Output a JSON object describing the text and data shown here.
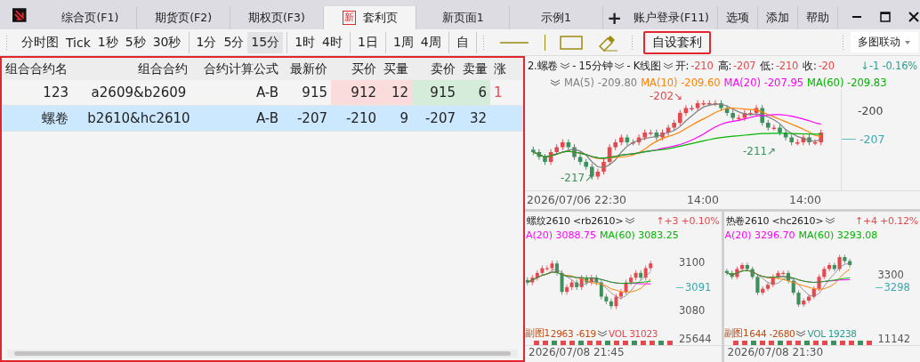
{
  "tabs": [
    {
      "label": "综合页(F1)",
      "selected": false
    },
    {
      "label": "期货页(F2)",
      "selected": false
    },
    {
      "label": "期权页(F3)",
      "selected": false
    },
    {
      "label": "套利页",
      "badge": "新",
      "selected": true
    },
    {
      "label": "新页面1",
      "selected": false
    },
    {
      "label": "示例1",
      "selected": false
    }
  ],
  "add_tab": "+",
  "menu": [
    "账户登录(F11)",
    "选项",
    "添加",
    "帮助"
  ],
  "toolbar": {
    "groups": [
      [
        {
          "label": "分时图",
          "selected": false
        },
        {
          "label": "Tick",
          "selected": false
        },
        {
          "label": "1秒",
          "selected": false
        },
        {
          "label": "5秒",
          "selected": false
        },
        {
          "label": "30秒",
          "selected": false
        }
      ],
      [
        {
          "label": "1分",
          "selected": false
        },
        {
          "label": "5分",
          "selected": false
        },
        {
          "label": "15分",
          "selected": true
        }
      ],
      [
        {
          "label": "1时",
          "selected": false
        },
        {
          "label": "4时",
          "selected": false
        }
      ],
      [
        {
          "label": "1日",
          "selected": false
        }
      ],
      [
        {
          "label": "1周",
          "selected": false
        },
        {
          "label": "4周",
          "selected": false
        }
      ],
      [
        {
          "label": "自",
          "selected": false
        }
      ]
    ],
    "custom_button": "自设套利",
    "linked_charts": "多图联动"
  },
  "table": {
    "columns": [
      {
        "label": "组合合约名",
        "kind": "text"
      },
      {
        "label": "组合合约",
        "kind": "text"
      },
      {
        "label": "合约计算公式",
        "kind": "text"
      },
      {
        "label": "最新价",
        "kind": "text"
      },
      {
        "label": "买价",
        "kind": "bid"
      },
      {
        "label": "买量",
        "kind": "bid"
      },
      {
        "label": "卖价",
        "kind": "ask"
      },
      {
        "label": "卖量",
        "kind": "ask"
      },
      {
        "label": "涨",
        "kind": "change"
      }
    ],
    "rows": [
      {
        "cells": [
          "123",
          "a2609&b2609",
          "A-B",
          "915",
          "912",
          "12",
          "915",
          "6",
          "1"
        ],
        "selected": false
      },
      {
        "cells": [
          "螺卷",
          "b2610&hc2610",
          "A-B",
          "-207",
          "-210",
          "9",
          "-207",
          "32"
        ],
        "selected": true
      }
    ]
  },
  "main_chart": {
    "contract": "2.螺卷",
    "period": "- 15分钟",
    "type": "- K线图",
    "ohlc": [
      {
        "label": "开:",
        "value": "-210"
      },
      {
        "label": "高:",
        "value": "-207"
      },
      {
        "label": "低:",
        "value": "-210"
      },
      {
        "label": "收:",
        "value": "-20"
      }
    ],
    "change": "↓-1 -0.16%",
    "ma": [
      {
        "label": "MA(5) -209.80",
        "color": "#808080"
      },
      {
        "label": "MA(10) -209.60",
        "color": "#ff8000"
      },
      {
        "label": "MA(20) -207.95",
        "color": "#ff00ff"
      },
      {
        "label": "MA(60) -209.83",
        "color": "#00b400"
      }
    ],
    "yaxis": [
      "-200",
      "-207"
    ],
    "annotations": [
      "-202↘",
      "-217↗",
      "-211↗"
    ],
    "xlabels": [
      "2026/07/06 22:30",
      "14:00",
      "14:00"
    ]
  },
  "sub_charts": [
    {
      "title": "螺纹2610 <rb2610>",
      "change": "↑+3 +0.10%",
      "ma": [
        {
          "label": "A(20) 3088.75",
          "color": "#ff00ff"
        },
        {
          "label": "MA(60) 3083.25",
          "color": "#00b400"
        }
      ],
      "yaxis": [
        "3100",
        "3091",
        "3080",
        "25644"
      ],
      "sub_title": "副图1",
      "sub_values": "2963 -619",
      "vol": "VOL 31023",
      "date": "2026/07/08 21:45"
    },
    {
      "title": "热卷2610 <hc2610>",
      "change": "↑+4 +0.12%",
      "ma": [
        {
          "label": "A(20) 3296.70",
          "color": "#ff00ff"
        },
        {
          "label": "MA(60) 3293.08",
          "color": "#00b400"
        }
      ],
      "yaxis": [
        "3300",
        "3298",
        "11142"
      ],
      "sub_title": "副图1",
      "sub_values": "644 -2680",
      "vol": "VOL 19238",
      "date": "2026/07/08 21:30"
    }
  ]
}
